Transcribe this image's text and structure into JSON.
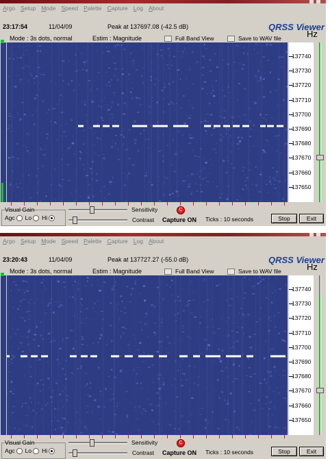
{
  "menu": [
    "Argo",
    "Setup",
    "Mode",
    "Speed",
    "Palette",
    "Capture",
    "Log",
    "About"
  ],
  "windows": [
    {
      "time": "23:17:54",
      "date": "11/04/09",
      "peak": "Peak at 137697.08 (-42.5 dB)",
      "brand": "QRSS Viewer",
      "hz_label": "Hz",
      "mode": "Mode : 3s dots, normal",
      "estim": "Estim : Magnitude",
      "full_band": "Full Band View",
      "save_wav": "Save to WAV file",
      "freq_labels": [
        "137740",
        "137730",
        "137720",
        "137710",
        "137700",
        "137690",
        "137680",
        "137670",
        "137660",
        "137650"
      ],
      "visual_gain": "Visual Gain",
      "agc": "Agc",
      "lo": "Lo",
      "hi": "Hi",
      "agc_selected": "Hi",
      "sensitivity": "Sensitivity",
      "contrast": "Contrast",
      "capture_on": "Capture ON",
      "ticks": "Ticks   : 10 seconds",
      "stop": "Stop",
      "exit": "Exit"
    },
    {
      "time": "23:20:43",
      "date": "11/04/09",
      "peak": "Peak at 137727.27 (-55.0 dB)",
      "brand": "QRSS Viewer",
      "hz_label": "Hz",
      "mode": "Mode : 3s dots, normal",
      "estim": "Estim : Magnitude",
      "full_band": "Full Band View",
      "save_wav": "Save to WAV file",
      "freq_labels": [
        "137740",
        "137730",
        "137720",
        "137710",
        "137700",
        "137690",
        "137680",
        "137670",
        "137660",
        "137650"
      ],
      "visual_gain": "Visual Gain",
      "agc": "Agc",
      "lo": "Lo",
      "hi": "Hi",
      "agc_selected": "Hi",
      "sensitivity": "Sensitivity",
      "contrast": "Contrast",
      "capture_on": "Capture ON",
      "ticks": "Ticks   : 10 seconds",
      "stop": "Stop",
      "exit": "Exit"
    }
  ],
  "colors": {
    "spectrogram_bg": "#2e3c83",
    "signal": "#ffffff",
    "brand": "#1d3f8f",
    "tick_red": "#d01515",
    "gain_green": "#14c32a"
  }
}
